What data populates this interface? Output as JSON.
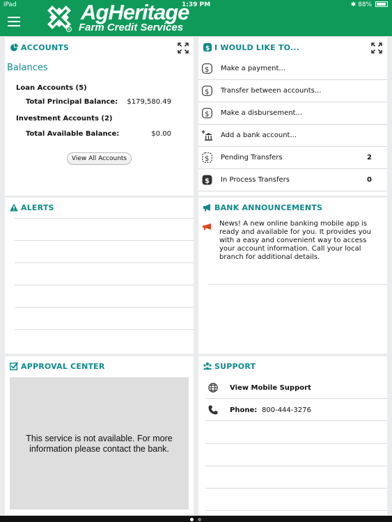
{
  "status": {
    "device": "iPad",
    "time": "1:39 PM",
    "battery": "88%"
  },
  "brand": {
    "title": "AgHeritage",
    "subtitle": "Farm Credit Services",
    "registered": "®"
  },
  "accounts": {
    "title": "ACCOUNTS",
    "heading": "Balances",
    "loan_label": "Loan Accounts (5)",
    "total_principal_label": "Total Principal Balance:",
    "total_principal_value": "$179,580.49",
    "investment_label": "Investment Accounts (2)",
    "total_available_label": "Total Available Balance:",
    "total_available_value": "$0.00",
    "view_all": "View All Accounts"
  },
  "would_like": {
    "title": "I WOULD LIKE TO...",
    "items": [
      {
        "label": "Make a payment...",
        "icon": "dollar-icon"
      },
      {
        "label": "Transfer between accounts...",
        "icon": "dollar-icon"
      },
      {
        "label": "Make a disbursement...",
        "icon": "dollar-icon"
      },
      {
        "label": "Add a bank account...",
        "icon": "bank-plus-icon"
      },
      {
        "label": "Pending Transfers",
        "icon": "dollar-dashed-icon",
        "count": "2"
      },
      {
        "label": "In Process Transfers",
        "icon": "dollar-filled-icon",
        "count": "0"
      }
    ]
  },
  "alerts": {
    "title": "ALERTS"
  },
  "announcements": {
    "title": "BANK ANNOUNCEMENTS",
    "text": "News!  A new online banking mobile app is ready and available for you. It provides you with a easy and convenient way to access your account information. Call your local branch for additional details."
  },
  "approval": {
    "title": "APPROVAL CENTER",
    "message": "This service is not available. For more information please contact the bank."
  },
  "support": {
    "title": "SUPPORT",
    "mobile_support": "View Mobile Support",
    "phone_label": "Phone:",
    "phone_value": "800-444-3276"
  },
  "colors": {
    "brand_green": "#0f9a5a",
    "title_teal": "#0f8a8a",
    "background": "#e9ebec"
  }
}
